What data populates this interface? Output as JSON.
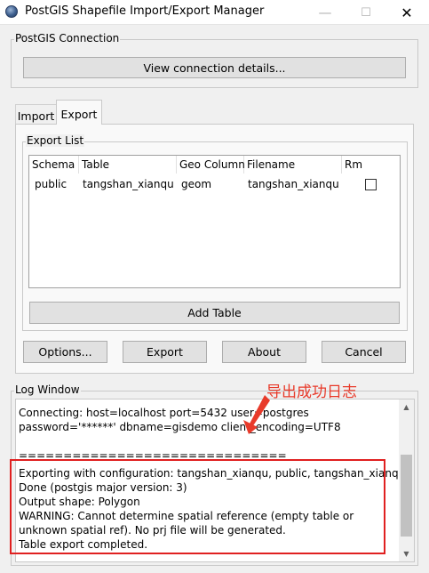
{
  "window": {
    "title": "PostGIS Shapefile Import/Export Manager",
    "minimize_icon": "minimize-icon",
    "maximize_icon": "maximize-icon",
    "close_icon": "close-icon"
  },
  "connection": {
    "group_label": "PostGIS Connection",
    "view_details_label": "View connection details..."
  },
  "tabs": [
    {
      "label": "Import",
      "active": false
    },
    {
      "label": "Export",
      "active": true
    }
  ],
  "export_list": {
    "group_label": "Export List",
    "columns": [
      "Schema",
      "Table",
      "Geo Column",
      "Filename",
      "Rm"
    ],
    "rows": [
      {
        "schema": "public",
        "table": "tangshan_xianqu",
        "geo_column": "geom",
        "filename": "tangshan_xianqu",
        "rm": false
      }
    ],
    "add_table_label": "Add Table"
  },
  "actions": {
    "options_label": "Options...",
    "export_label": "Export",
    "about_label": "About",
    "cancel_label": "Cancel"
  },
  "log": {
    "group_label": "Log Window",
    "lines": [
      "Connecting:  host=localhost port=5432 user=postgres",
      "password='******' dbname=gisdemo client_encoding=UTF8",
      "",
      "==============================",
      "Exporting with configuration: tangshan_xianqu, public, tangshan_xianqu",
      "Done (postgis major version: 3)",
      "Output shape: Polygon",
      "WARNING: Cannot determine spatial reference (empty table or",
      "unknown spatial ref). No prj file will be generated.",
      "Table export completed."
    ]
  },
  "annotation": {
    "text": "导出成功日志",
    "color": "#e83a2a"
  },
  "colors": {
    "highlight_border": "#e02020",
    "button_face": "#e1e1e1",
    "background": "#f0f0f0"
  }
}
